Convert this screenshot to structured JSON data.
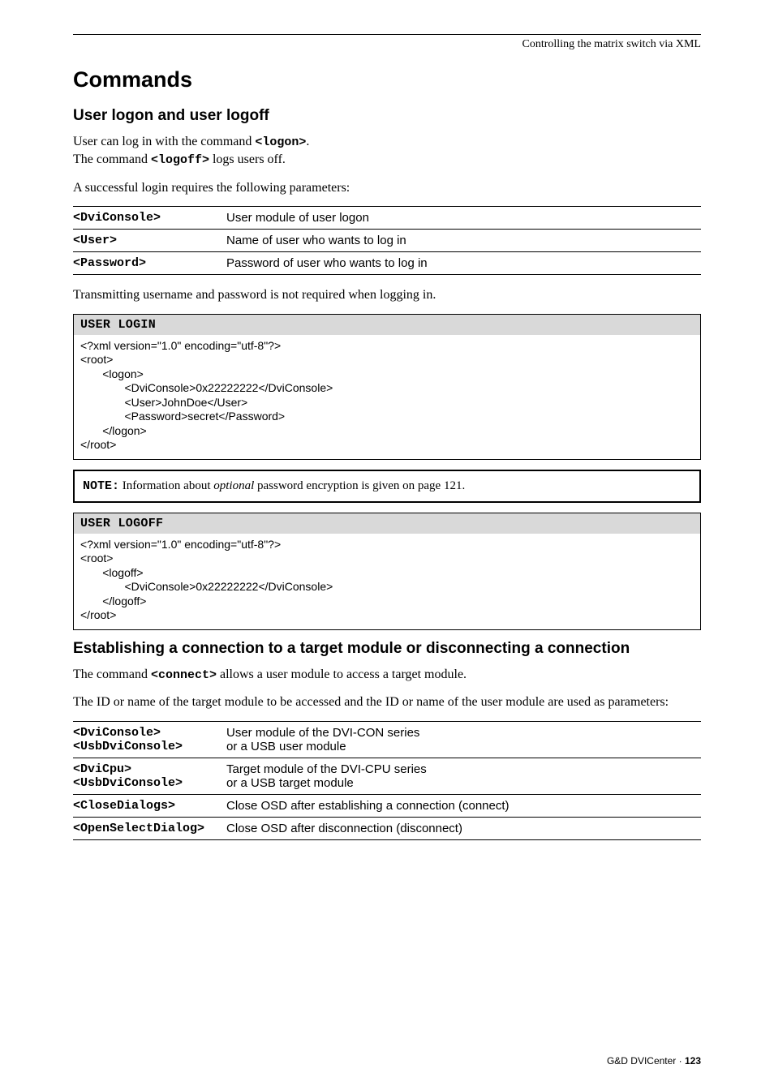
{
  "running_head": "Controlling the matrix switch via XML",
  "h1": "Commands",
  "sec1": {
    "heading": "User logon and user logoff",
    "para1_a": "User can log in with the command ",
    "para1_cmd1": "<logon>",
    "para1_b": ".",
    "para2_a": "The command ",
    "para2_cmd": "<logoff>",
    "para2_b": " logs users off.",
    "para3": "A successful login requires the following parameters:",
    "table": [
      {
        "key": "<DviConsole>",
        "desc": "User module of user logon"
      },
      {
        "key": "<User>",
        "desc": "Name of user who wants to log in"
      },
      {
        "key": "<Password>",
        "desc": "Password  of user who wants to log in"
      }
    ],
    "para4": "Transmitting username and password is not required when logging in.",
    "code1_header": "USER LOGIN",
    "code1_body": "<?xml version=\"1.0\" encoding=\"utf-8\"?>\n<root>\n       <logon>\n              <DviConsole>0x22222222</DviConsole>\n              <User>JohnDoe</User>\n              <Password>secret</Password>\n       </logon>\n</root>",
    "note_label": "NOTE:",
    "note_a": " Information about ",
    "note_italic": "optional",
    "note_b": " password encryption is given on page 121.",
    "code2_header": "USER LOGOFF",
    "code2_body": "<?xml version=\"1.0\" encoding=\"utf-8\"?>\n<root>\n       <logoff>\n              <DviConsole>0x22222222</DviConsole>\n       </logoff>\n</root>"
  },
  "sec2": {
    "heading": "Establishing a connection to a target module or disconnecting a connection",
    "para1_a": "The command ",
    "para1_cmd": "<connect>",
    "para1_b": " allows a user module to access a target module.",
    "para2": "The ID or name of the target module to be accessed and the ID or name of the user module are used as parameters:",
    "table": [
      {
        "key": "<DviConsole>\n<UsbDviConsole>",
        "desc": "User module of the DVI-CON series\nor a USB user module"
      },
      {
        "key": "<DviCpu>\n<UsbDviConsole>",
        "desc": "Target module of the DVI-CPU series\nor a USB target module"
      },
      {
        "key": "<CloseDialogs>",
        "desc": "Close OSD after establishing a connection (connect)"
      },
      {
        "key": "<OpenSelectDialog>",
        "desc": "Close OSD after disconnection (disconnect)"
      }
    ]
  },
  "footer_text": "G&D DVICenter · ",
  "footer_page": "123"
}
